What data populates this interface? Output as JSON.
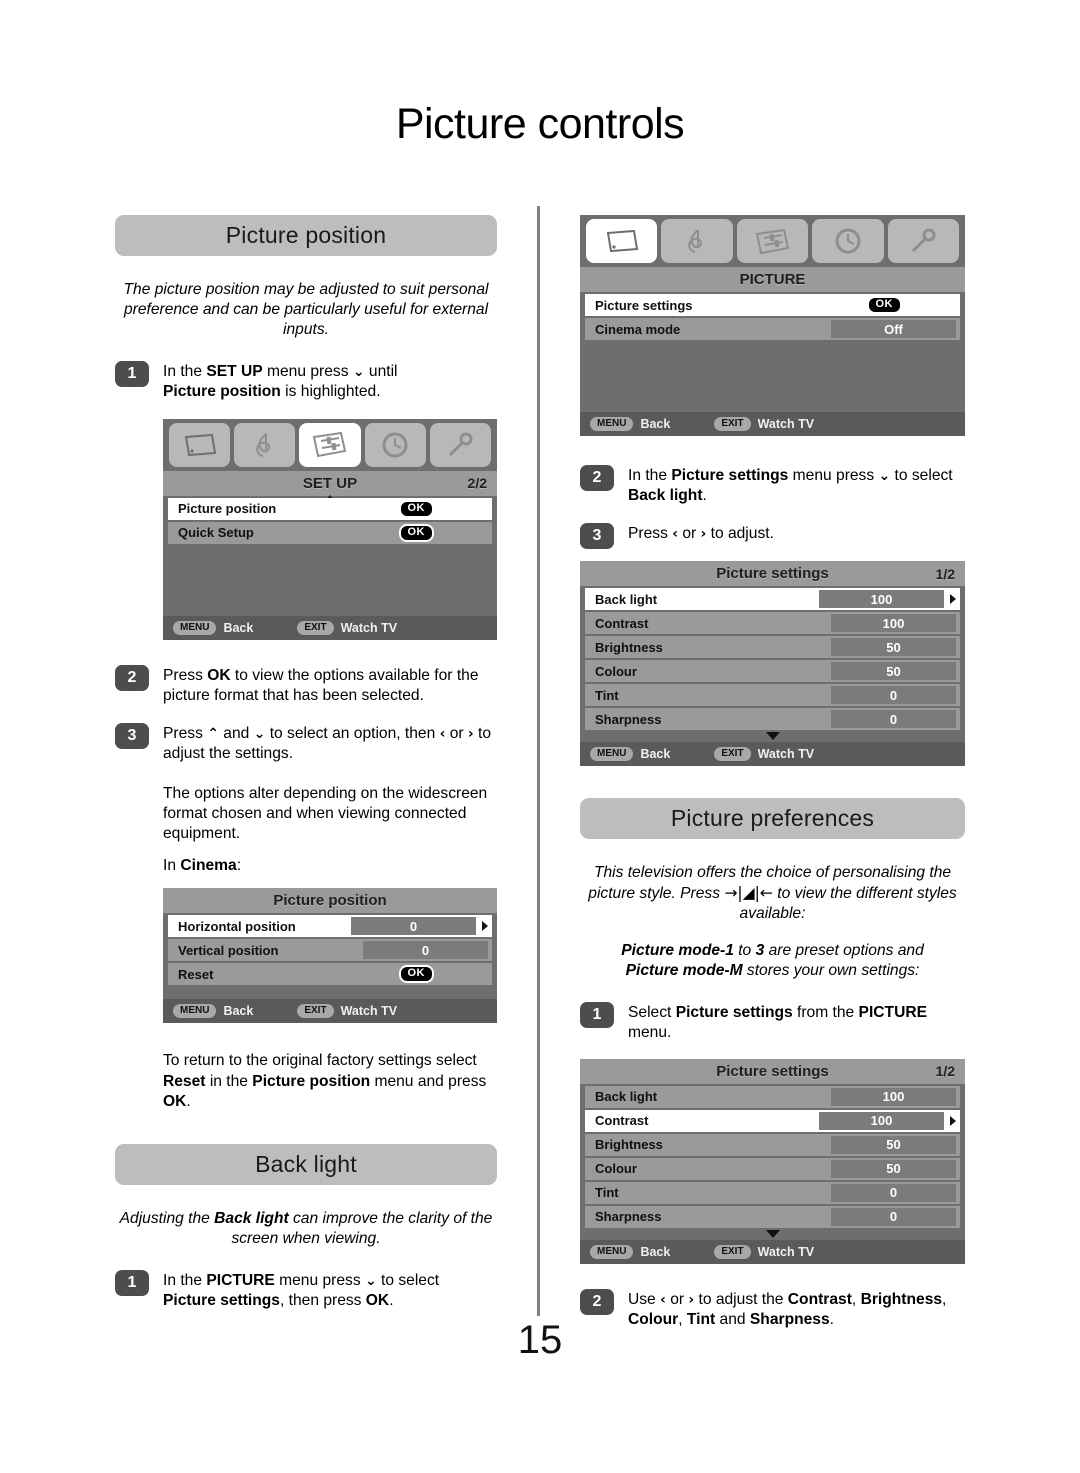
{
  "page": {
    "title": "Picture controls",
    "number": "15"
  },
  "left_column": {
    "section1": {
      "heading": "Picture position",
      "intro": "The picture position may be adjusted to suit personal preference and can be particularly useful for external inputs.",
      "step1_num": "1",
      "step1_text_a": "In the ",
      "step1_bold_a": "SET UP",
      "step1_text_b": " menu press ",
      "step1_arrow": "⌄",
      "step1_text_c": " until ",
      "step1_bold_b": "Picture position",
      "step1_text_d": " is highlighted.",
      "step2_num": "2",
      "step2_text_a": "Press ",
      "step2_bold_a": "OK",
      "step2_text_b": " to view the options available for the picture format that has been selected.",
      "step3_num": "3",
      "step3_text_a": "Press ",
      "step3_up": "⌃",
      "step3_text_b": " and ",
      "step3_down": "⌄",
      "step3_text_c": " to select an option, then ",
      "step3_left": "‹",
      "step3_text_d": " or ",
      "step3_right": "›",
      "step3_text_e": " to adjust the settings.",
      "note": "The options alter depending on the widescreen format chosen and when viewing connected equipment.",
      "cinema_prefix": "In ",
      "cinema_bold": "Cinema",
      "cinema_suffix": ":",
      "reset_text_a": "To return to the original factory settings select ",
      "reset_bold_a": "Reset",
      "reset_text_b": " in the ",
      "reset_bold_b": "Picture position",
      "reset_text_c": " menu and press ",
      "reset_bold_c": "OK",
      "reset_text_d": "."
    },
    "section2": {
      "heading": "Back light",
      "intro_a": "Adjusting the ",
      "intro_bold": "Back light",
      "intro_b": " can improve the clarity of the screen when viewing.",
      "step1_num": "1",
      "step1_text_a": "In the ",
      "step1_bold_a": "PICTURE",
      "step1_text_b": " menu press ",
      "step1_arrow": "⌄",
      "step1_text_c": " to select ",
      "step1_bold_b": "Picture settings",
      "step1_text_d": ", then press ",
      "step1_bold_c": "OK",
      "step1_text_e": "."
    }
  },
  "right_column": {
    "step2_num": "2",
    "step2_text_a": "In the ",
    "step2_bold_a": "Picture settings",
    "step2_text_b": " menu press ",
    "step2_arrow": "⌄",
    "step2_text_c": " to select ",
    "step2_bold_b": "Back light",
    "step2_text_d": ".",
    "step3_num": "3",
    "step3_text_a": "Press ",
    "step3_left": "‹",
    "step3_text_b": " or ",
    "step3_right": "›",
    "step3_text_c": " to adjust.",
    "section3": {
      "heading": "Picture preferences",
      "intro_a": "This television offers the choice of personalising the picture style. Press ",
      "intro_symbol": "→|◢|←",
      "intro_b": " to view the different styles available:",
      "modes_bold_a": "Picture mode-1",
      "modes_text_a": " to ",
      "modes_bold_b": "3",
      "modes_text_b": " are preset options and ",
      "modes_bold_c": "Picture mode-M",
      "modes_text_c": " stores your own settings:",
      "step1_num": "1",
      "step1_text_a": "Select ",
      "step1_bold_a": "Picture settings",
      "step1_text_b": " from the ",
      "step1_bold_b": "PICTURE",
      "step1_text_c": " menu.",
      "step2_num": "2",
      "step2_text_a": "Use ",
      "step2_left": "‹",
      "step2_text_b": " or ",
      "step2_right": "›",
      "step2_text_c": " to adjust the ",
      "step2_bold_a": "Contrast",
      "step2_text_d": ", ",
      "step2_bold_b": "Brightness",
      "step2_text_e": ", ",
      "step2_bold_c": "Colour",
      "step2_text_f": ", ",
      "step2_bold_d": "Tint",
      "step2_text_g": " and ",
      "step2_bold_e": "Sharpness",
      "step2_text_h": "."
    }
  },
  "osd_common": {
    "icons": [
      "tv-picture-icon",
      "music-note-icon",
      "settings-sliders-icon",
      "clock-icon",
      "wrench-icon"
    ],
    "footer_menu_key": "MENU",
    "footer_menu_label": "Back",
    "footer_exit_key": "EXIT",
    "footer_exit_label": "Watch TV",
    "ok_badge": "OK"
  },
  "osd_setup": {
    "title": "SET UP",
    "page": "2/2",
    "active_icon_index": 2,
    "rows": [
      {
        "label": "Picture position",
        "value": "",
        "type": "ok",
        "selected": true
      },
      {
        "label": "Quick Setup",
        "value": "",
        "type": "ok",
        "selected": false
      }
    ]
  },
  "osd_picture_position": {
    "title": "Picture position",
    "page": "",
    "rows": [
      {
        "label": "Horizontal position",
        "value": "0",
        "type": "value",
        "selected": true
      },
      {
        "label": "Vertical position",
        "value": "0",
        "type": "value",
        "selected": false
      },
      {
        "label": "Reset",
        "value": "",
        "type": "ok",
        "selected": false
      }
    ]
  },
  "osd_picture": {
    "title": "PICTURE",
    "page": "",
    "active_icon_index": 0,
    "rows": [
      {
        "label": "Picture settings",
        "value": "",
        "type": "ok",
        "selected": true
      },
      {
        "label": "Cinema mode",
        "value": "Off",
        "type": "value-plain",
        "selected": false
      }
    ]
  },
  "osd_picture_settings_1": {
    "title": "Picture settings",
    "page": "1/2",
    "rows": [
      {
        "label": "Back light",
        "value": "100",
        "type": "value",
        "selected": true
      },
      {
        "label": "Contrast",
        "value": "100",
        "type": "value-plain",
        "selected": false
      },
      {
        "label": "Brightness",
        "value": "50",
        "type": "value-plain",
        "selected": false
      },
      {
        "label": "Colour",
        "value": "50",
        "type": "value-plain",
        "selected": false
      },
      {
        "label": "Tint",
        "value": "0",
        "type": "value-plain",
        "selected": false
      },
      {
        "label": "Sharpness",
        "value": "0",
        "type": "value-plain",
        "selected": false
      }
    ]
  },
  "osd_picture_settings_2": {
    "title": "Picture settings",
    "page": "1/2",
    "rows": [
      {
        "label": "Back light",
        "value": "100",
        "type": "value-plain",
        "selected": false
      },
      {
        "label": "Contrast",
        "value": "100",
        "type": "value",
        "selected": true
      },
      {
        "label": "Brightness",
        "value": "50",
        "type": "value-plain",
        "selected": false
      },
      {
        "label": "Colour",
        "value": "50",
        "type": "value-plain",
        "selected": false
      },
      {
        "label": "Tint",
        "value": "0",
        "type": "value-plain",
        "selected": false
      },
      {
        "label": "Sharpness",
        "value": "0",
        "type": "value-plain",
        "selected": false
      }
    ]
  },
  "colors": {
    "pill_gray": "#bdbdbd",
    "step_badge": "#4d4d4d",
    "osd_bg": "#6e6e6e",
    "osd_row": "#9a9a9a",
    "osd_row_selected": "#ffffff",
    "osd_value": "#7b7b7b",
    "osd_footer": "#5a5a5a",
    "divider": "#808080"
  }
}
